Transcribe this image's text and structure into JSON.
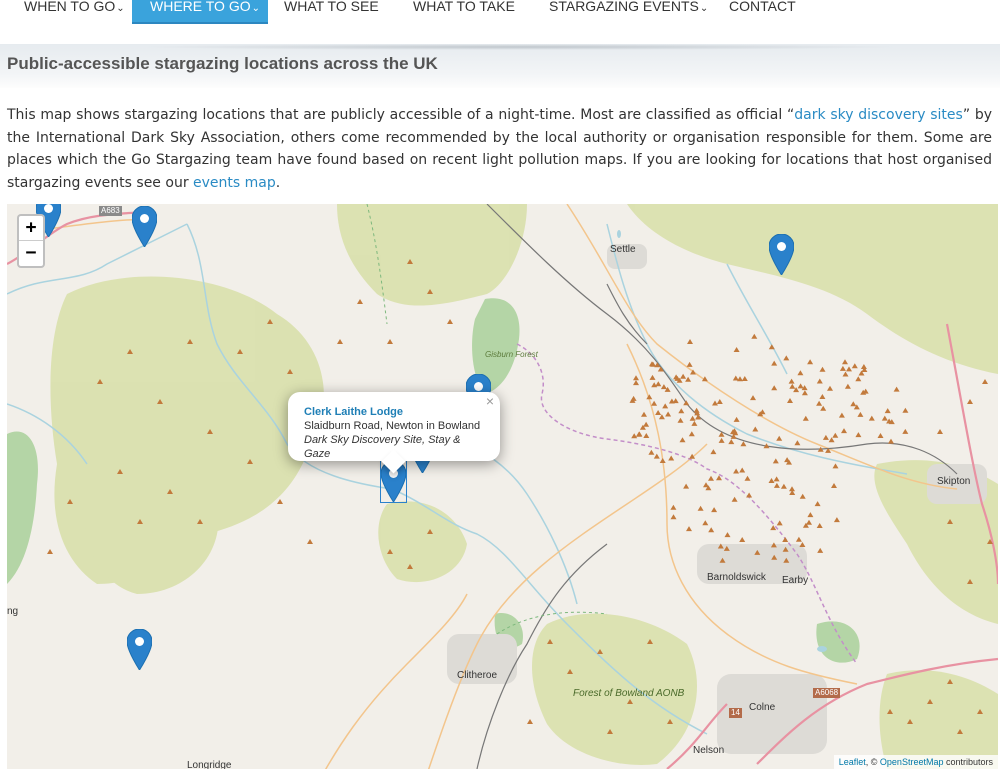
{
  "nav": {
    "items": [
      {
        "label": "WHEN TO GO",
        "has_dropdown": true
      },
      {
        "label": "WHERE TO GO",
        "has_dropdown": true,
        "active": true
      },
      {
        "label": "WHAT TO SEE",
        "has_dropdown": false
      },
      {
        "label": "WHAT TO TAKE",
        "has_dropdown": false
      },
      {
        "label": "STARGAZING EVENTS",
        "has_dropdown": true
      },
      {
        "label": "CONTACT",
        "has_dropdown": false
      }
    ],
    "chevron": "⌄",
    "active_color": "#3aa3dc"
  },
  "page": {
    "title": "Public-accessible stargazing locations across the UK"
  },
  "intro": {
    "text_1": "This map shows stargazing locations that are publicly accessible of a night-time. Most are classified as official “",
    "link_1": "dark sky discovery sites",
    "text_2": "” by the International Dark Sky Association, others come recommended by the local authority or organisation responsible for them. Some are places which the Go Stargazing team have found based on recent light pollution maps. If you are looking for locations that host organised stargazing events see our ",
    "link_2": "events map",
    "text_3": "."
  },
  "map": {
    "zoom_in": "+",
    "zoom_out": "−",
    "popup": {
      "title": "Clerk Laithe Lodge",
      "address": "Slaidburn Road, Newton in Bowland",
      "description": "Dark Sky Discovery Site, Stay & Gaze",
      "close": "×"
    },
    "place_labels": {
      "settle": "Settle",
      "skipton": "Skipton",
      "barnoldswick": "Barnoldswick",
      "earby": "Earby",
      "clitheroe": "Clitheroe",
      "colne": "Colne",
      "nelson": "Nelson",
      "longridge": "Longridge",
      "ng": "ng",
      "gisburn_forest": "Gisburn Forest",
      "forest_of_bowland": "Forest of Bowland AONB"
    },
    "road_labels": {
      "a683": "A683",
      "a6068": "A6068",
      "r14": "14"
    },
    "attribution": {
      "leaflet": "Leaflet",
      "sep": ", © ",
      "osm": "OpenStreetMap",
      "contrib": " contributors"
    },
    "marker_color": "#2a81cb",
    "park_color": "#d9e0ac",
    "peak_color": "#c27a3c"
  }
}
